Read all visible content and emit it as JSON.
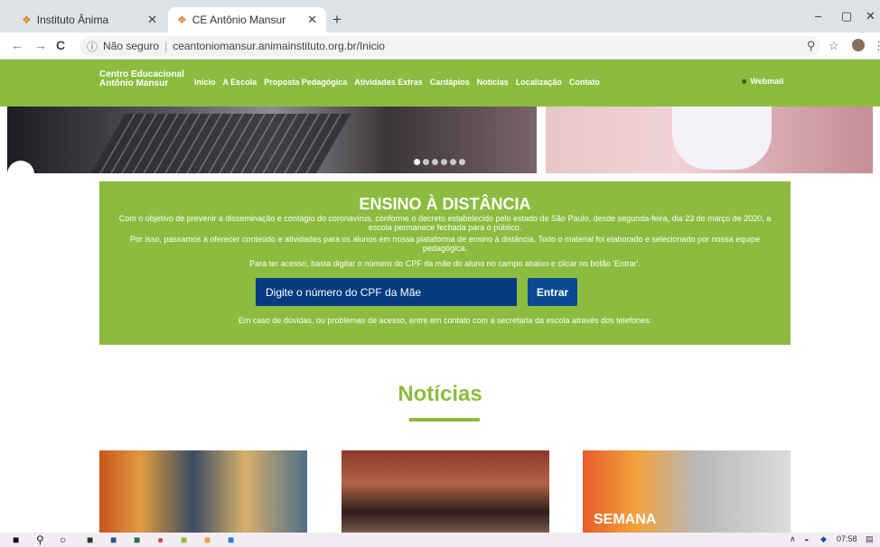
{
  "browser": {
    "tabs": [
      {
        "title": "Instituto Ânima",
        "active": false
      },
      {
        "title": "CE Antônio Mansur",
        "active": true
      }
    ],
    "new_tab": "+",
    "window_controls": {
      "minimize": "–",
      "restore": "▢",
      "close": "✕"
    },
    "nav": {
      "back": "←",
      "forward": "→",
      "reload": "C"
    },
    "address": {
      "security": "Não seguro",
      "separator": "|",
      "url": "ceantoniomansur.animainstituto.org.br/Inicio"
    }
  },
  "site": {
    "logo_line1": "Centro Educacional",
    "logo_line2": "Antônio Mansur",
    "menu": [
      "Início",
      "A Escola",
      "Proposta Pedagógica",
      "Atividades Extras",
      "Cardápios",
      "Notícias",
      "Localização",
      "Contato"
    ],
    "webmail": "Webmail",
    "accent_color": "#8cbc3f"
  },
  "hero": {
    "slides_count": 6,
    "active_slide": 1
  },
  "ead": {
    "title": "ENSINO À DISTÂNCIA",
    "p1_line1": "Com o objetivo de prevenir a disseminação e contágio do coronavírus, conforme o decreto estabelecido pelo estado de São Paulo, desde segunda-feira, dia 23 de março de 2020, a",
    "p1_line2": "escola permanece fechada para o público.",
    "p2_line1": "Por isso, passamos a oferecer conteúdo e atividades para os alunos em nossa plataforma de ensino à distância. Todo o material foi elaborado e selecionado por nossa equipe",
    "p2_line2": "pedagógica.",
    "p3": "Para ter acesso, basta digitar o número do CPF da mãe do aluno no campo abaixo e clicar no botão 'Entrar'.",
    "input_placeholder": "Digite o número do CPF da Mãe",
    "button": "Entrar",
    "p4": "Em caso de dúvidas, ou problemas de acesso, entre em contato com a secretaria da escola através dos telefones:"
  },
  "news": {
    "title": "Notícias",
    "cards": [
      {
        "caption": ""
      },
      {
        "caption": ""
      },
      {
        "caption": "SEMANA"
      }
    ]
  },
  "taskbar": {
    "time": "07:58"
  }
}
